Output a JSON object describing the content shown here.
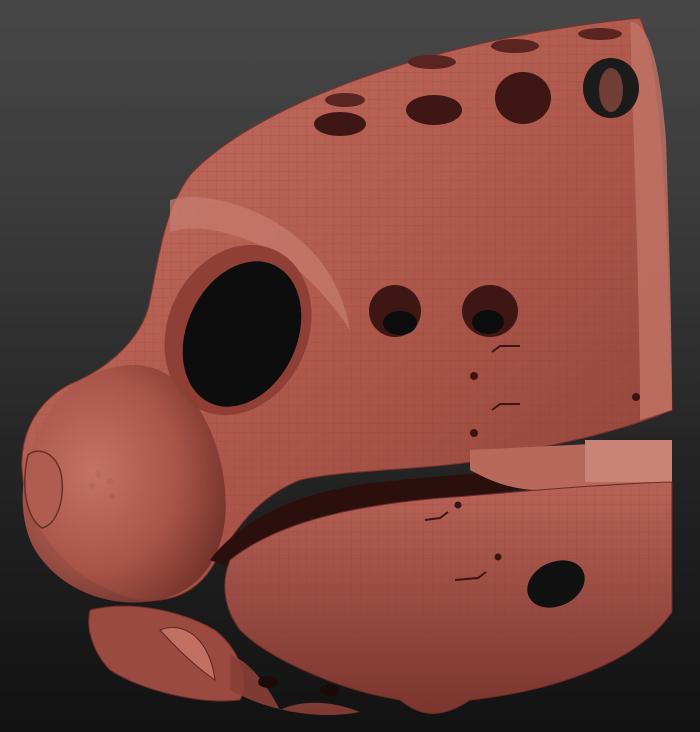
{
  "scene": {
    "subject": "mask-model",
    "material": {
      "base": "#a9564b",
      "light": "#c9786b",
      "shadow": "#6b2c26",
      "deep": "#3e1714",
      "wire": "#8a3f36"
    },
    "background": [
      "#474747",
      "#121212"
    ]
  }
}
